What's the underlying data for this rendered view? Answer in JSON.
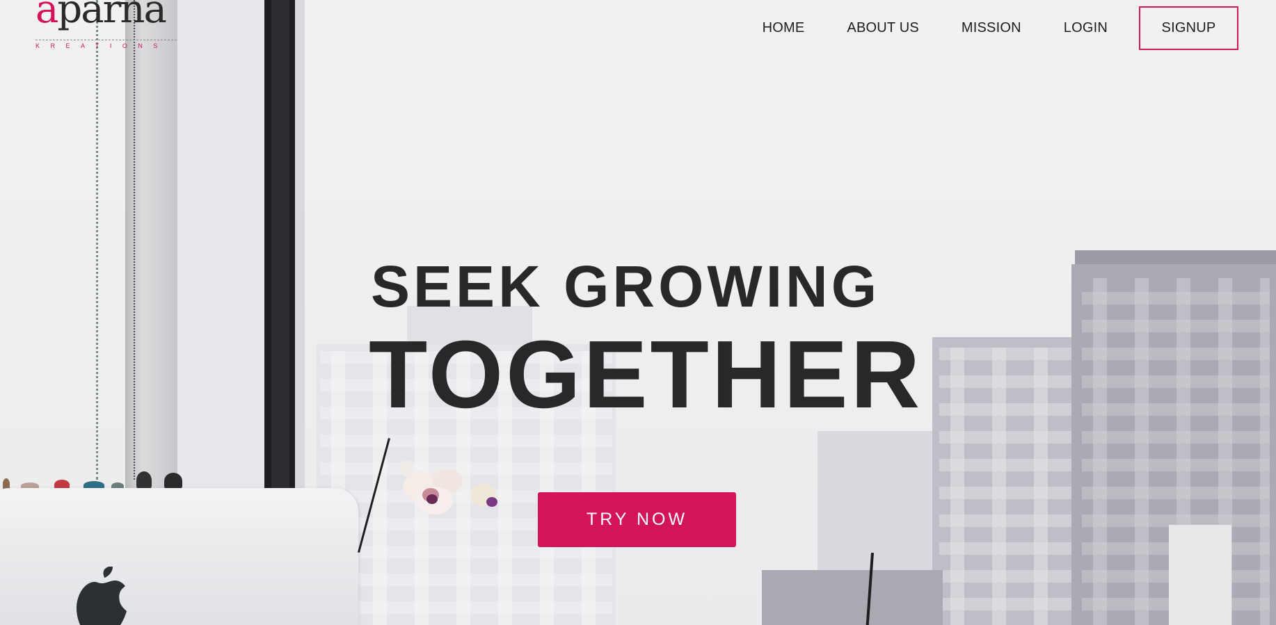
{
  "brand": {
    "logo_accent": "a",
    "logo_rest": "parna",
    "logo_subtitle": "KREATIONS",
    "accent_color": "#d4145a"
  },
  "nav": {
    "items": [
      {
        "label": "HOME"
      },
      {
        "label": "ABOUT US"
      },
      {
        "label": "MISSION"
      },
      {
        "label": "LOGIN"
      }
    ],
    "signup_label": "SIGNUP"
  },
  "hero": {
    "line1": "SEEK GROWING",
    "line2": "TOGETHER",
    "cta_label": "TRY NOW"
  },
  "icons": {
    "laptop_logo": "apple-logo-icon"
  }
}
